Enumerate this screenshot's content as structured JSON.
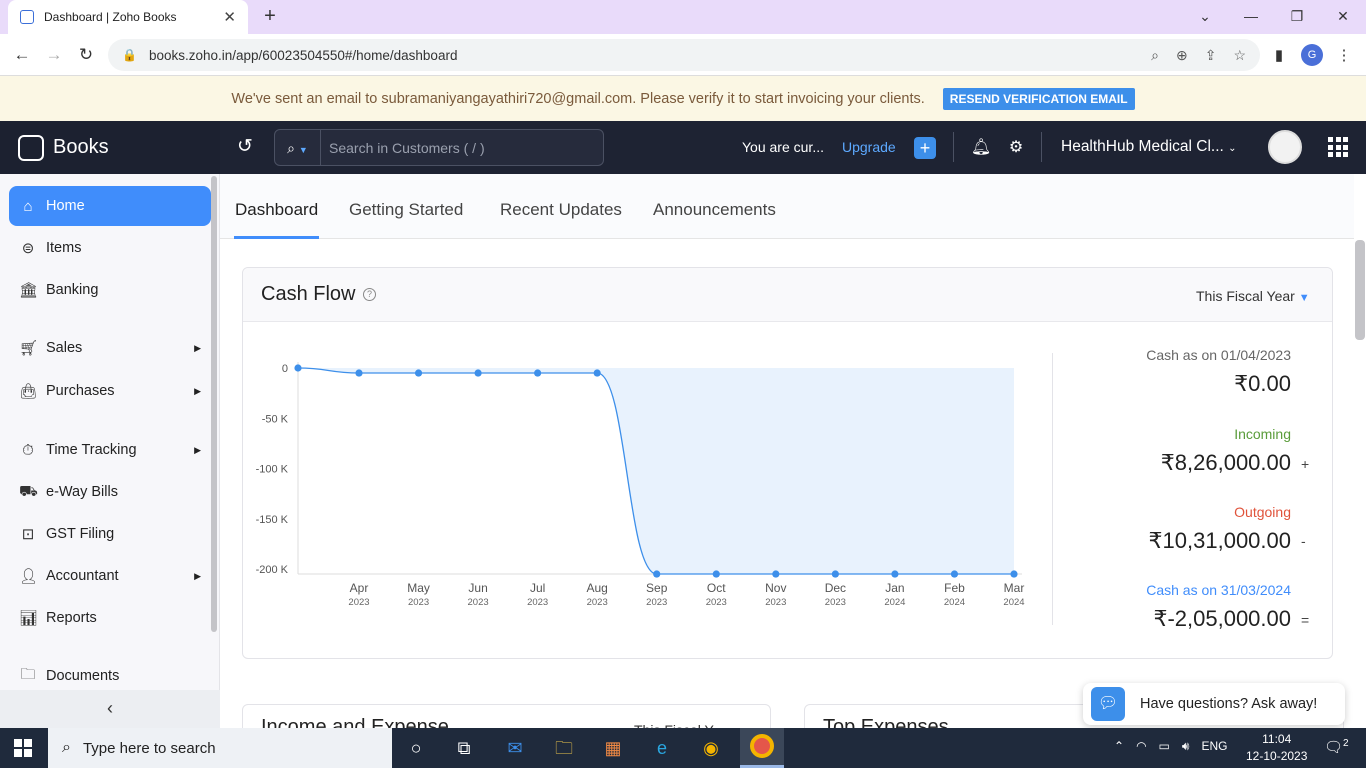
{
  "browser": {
    "tab_title": "Dashboard | Zoho Books",
    "url": "books.zoho.in/app/60023504550#/home/dashboard",
    "profile_initial": "G"
  },
  "banner": {
    "message": "We've sent an email to subramaniyangayathiri720@gmail.com. Please verify it to start invoicing your clients.",
    "button": "RESEND VERIFICATION EMAIL"
  },
  "header": {
    "brand": "Books",
    "search_placeholder": "Search in Customers ( / )",
    "trial_text": "You are cur...",
    "upgrade": "Upgrade",
    "org_name": "HealthHub Medical Cl..."
  },
  "sidebar": {
    "items": [
      {
        "label": "Home",
        "icon": "home-icon",
        "active": true
      },
      {
        "label": "Items",
        "icon": "items-icon"
      },
      {
        "label": "Banking",
        "icon": "bank-icon"
      },
      {
        "label": "Sales",
        "icon": "cart-icon",
        "submenu": true
      },
      {
        "label": "Purchases",
        "icon": "bag-icon",
        "submenu": true
      },
      {
        "label": "Time Tracking",
        "icon": "timer-icon",
        "submenu": true
      },
      {
        "label": "e-Way Bills",
        "icon": "truck-icon"
      },
      {
        "label": "GST Filing",
        "icon": "gst-icon"
      },
      {
        "label": "Accountant",
        "icon": "person-icon",
        "submenu": true
      },
      {
        "label": "Reports",
        "icon": "chart-icon"
      },
      {
        "label": "Documents",
        "icon": "folder-icon"
      }
    ]
  },
  "tabs": [
    "Dashboard",
    "Getting Started",
    "Recent Updates",
    "Announcements"
  ],
  "cashflow": {
    "title": "Cash Flow",
    "period": "This Fiscal Year",
    "opening_label": "Cash as on 01/04/2023",
    "opening_value": "₹0.00",
    "incoming_label": "Incoming",
    "incoming_value": "₹8,26,000.00",
    "incoming_op": "+",
    "outgoing_label": "Outgoing",
    "outgoing_value": "₹10,31,000.00",
    "outgoing_op": "-",
    "closing_label": "Cash as on 31/03/2024",
    "closing_value": "₹-2,05,000.00",
    "closing_op": "="
  },
  "chart_data": {
    "type": "area",
    "categories": [
      {
        "month": "Apr",
        "year": "2023"
      },
      {
        "month": "May",
        "year": "2023"
      },
      {
        "month": "Jun",
        "year": "2023"
      },
      {
        "month": "Jul",
        "year": "2023"
      },
      {
        "month": "Aug",
        "year": "2023"
      },
      {
        "month": "Sep",
        "year": "2023"
      },
      {
        "month": "Oct",
        "year": "2023"
      },
      {
        "month": "Nov",
        "year": "2023"
      },
      {
        "month": "Dec",
        "year": "2023"
      },
      {
        "month": "Jan",
        "year": "2024"
      },
      {
        "month": "Feb",
        "year": "2024"
      },
      {
        "month": "Mar",
        "year": "2024"
      }
    ],
    "start_value": 0,
    "values": [
      -5000,
      -5000,
      -5000,
      -5000,
      -5000,
      -205000,
      -205000,
      -205000,
      -205000,
      -205000,
      -205000,
      -205000
    ],
    "y_ticks": [
      "0",
      "-50 K",
      "-100 K",
      "-150 K",
      "-200 K"
    ],
    "ylim": [
      -200000,
      0
    ],
    "colors": {
      "line": "#3d8fea",
      "fill": "#e8f2fd"
    }
  },
  "bottom": {
    "income_title": "Income and Expense",
    "income_period": "This Fiscal Y...",
    "expenses_title": "Top Expenses"
  },
  "chat": {
    "text": "Have questions? Ask away!"
  },
  "taskbar": {
    "search_placeholder": "Type here to search",
    "lang": "ENG",
    "time": "11:04",
    "date": "12-10-2023",
    "notifications": "2"
  }
}
